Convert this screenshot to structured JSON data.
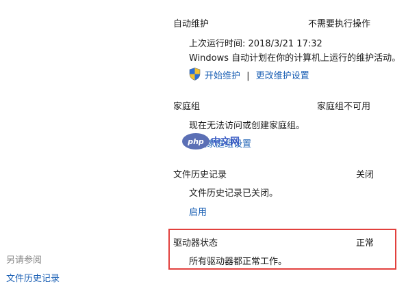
{
  "maintenance": {
    "title": "自动维护",
    "status": "不需要执行操作",
    "last_run": "上次运行时间: 2018/3/21 17:32",
    "description": "Windows 自动计划在你的计算机上运行的维护活动。",
    "start_link": "开始维护",
    "separator": "|",
    "change_link": "更改维护设置"
  },
  "homegroup": {
    "title": "家庭组",
    "status": "家庭组不可用",
    "description": "现在无法访问或创建家庭组。",
    "settings_link": "更改家庭组设置"
  },
  "file_history": {
    "title": "文件历史记录",
    "status": "关闭",
    "description": "文件历史记录已关闭。",
    "enable_link": "启用"
  },
  "drive_status": {
    "title": "驱动器状态",
    "status": "正常",
    "description": "所有驱动器都正常工作。"
  },
  "see_also": {
    "title": "另请参阅",
    "items": [
      "文件历史记录"
    ]
  },
  "watermark": {
    "logo": "php",
    "text": "中文网"
  },
  "colors": {
    "link": "#1a5fb4",
    "highlight": "#e2403d",
    "watermark": "#3b5cc4"
  },
  "icons": {
    "shield": "uac-shield-icon"
  }
}
